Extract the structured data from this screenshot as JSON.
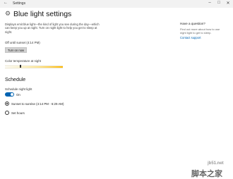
{
  "window": {
    "title": "Settings"
  },
  "page": {
    "title": "Blue light settings",
    "description": "Displays emit blue light—the kind of light you see during the day—which can keep you up at night. Turn on night light to help you get to sleep at night.",
    "status_text": "Off until sunset (4:14 PM)",
    "turn_on_button": "Turn on now",
    "color_temperature_label": "Color temperature at night",
    "color_temperature_level": 0.26
  },
  "schedule": {
    "heading": "Schedule",
    "toggle_label": "Schedule night light",
    "toggle_state": "On",
    "options": [
      {
        "label": "Sunset to sunrise (4:14 PM - 6:29 AM)",
        "checked": true
      },
      {
        "label": "Set hours",
        "checked": false
      }
    ]
  },
  "help": {
    "title": "Have a question?",
    "text": "Find out more about how to use night light to get to sleep.",
    "link": "Contact support"
  },
  "watermark": {
    "line1": "jb51.net",
    "line2": "脚本之家"
  },
  "colors": {
    "accent": "#0063b1",
    "slider_warm": "#ffb800"
  }
}
